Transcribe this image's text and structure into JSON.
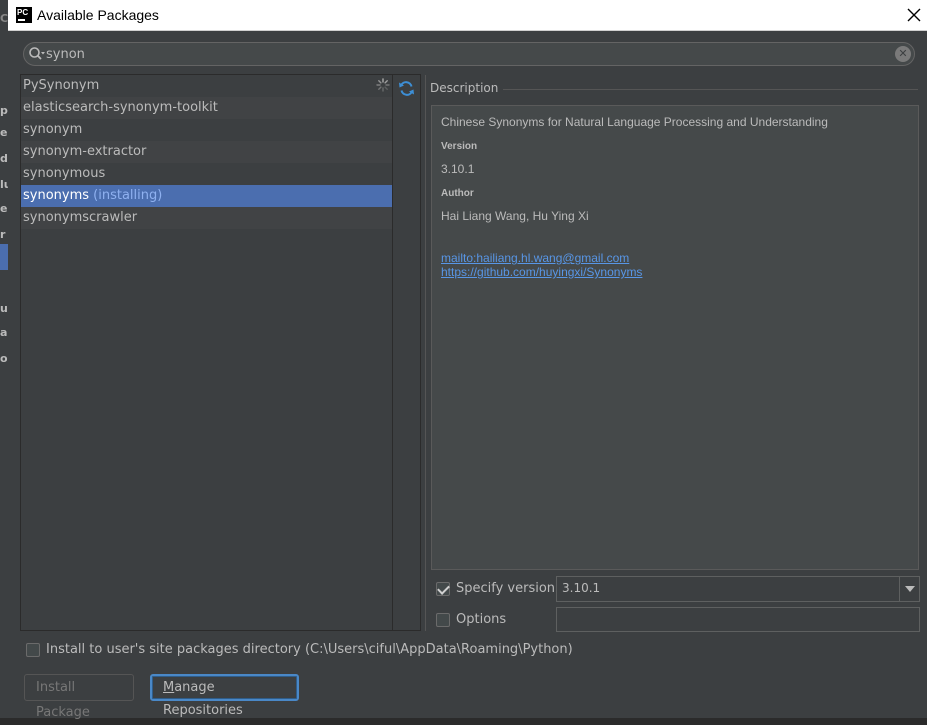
{
  "window": {
    "title": "Available Packages",
    "app_icon_text": "PC",
    "close_icon": "close-icon"
  },
  "background_fragments": [
    "C",
    "p",
    "e",
    "d",
    "lu",
    "e",
    "r",
    "u",
    "a",
    "o"
  ],
  "search": {
    "value": "synon",
    "icon": "search-icon",
    "clear_icon": "clear-icon"
  },
  "packages": [
    {
      "name": "PySynonym",
      "status": ""
    },
    {
      "name": "elasticsearch-synonym-toolkit",
      "status": ""
    },
    {
      "name": "synonym",
      "status": ""
    },
    {
      "name": "synonym-extractor",
      "status": ""
    },
    {
      "name": "synonymous",
      "status": ""
    },
    {
      "name": "synonyms",
      "status": "(installing)",
      "selected": true
    },
    {
      "name": "synonymscrawler",
      "status": ""
    }
  ],
  "description": {
    "label": "Description",
    "summary": "Chinese Synonyms for Natural Language Processing and Understanding",
    "version_heading": "Version",
    "version": "3.10.1",
    "author_heading": "Author",
    "author": "Hai Liang Wang, Hu Ying Xi",
    "links": [
      "mailto:hailiang.hl.wang@gmail.com",
      "https://github.com/huyingxi/Synonyms"
    ]
  },
  "specify_version": {
    "label": "Specify version",
    "checked": true,
    "value": "3.10.1"
  },
  "options": {
    "label": "Options",
    "checked": false,
    "value": ""
  },
  "install_to_user": {
    "label": "Install to user's site packages directory (C:\\Users\\ciful\\AppData\\Roaming\\Python)",
    "checked": false
  },
  "buttons": {
    "install": "Install Package",
    "manage_mnemonic": "M",
    "manage_rest": "anage Repositories"
  }
}
